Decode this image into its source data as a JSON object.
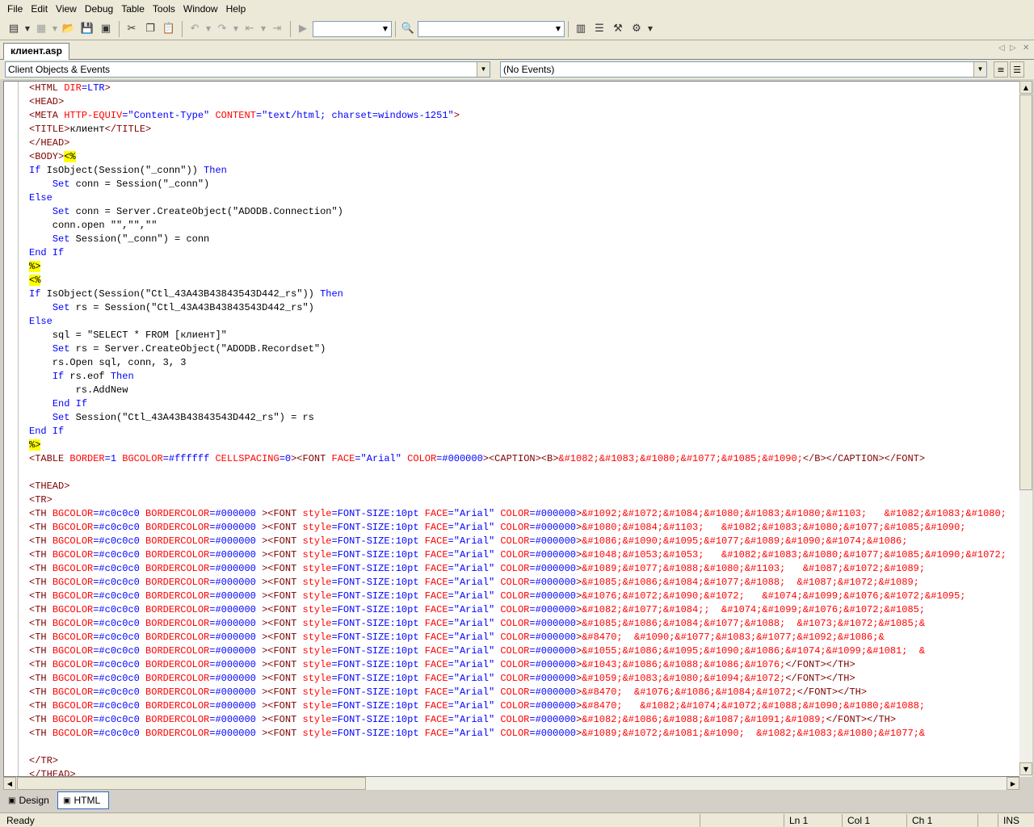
{
  "menu": [
    "File",
    "Edit",
    "View",
    "Debug",
    "Table",
    "Tools",
    "Window",
    "Help"
  ],
  "document_tab": "клиент.asp",
  "object_selector": "Client Objects & Events",
  "event_selector": "(No Events)",
  "code_lines": [
    [
      [
        "t",
        "<HTML "
      ],
      [
        "a",
        "DIR"
      ],
      [
        "v",
        "=LTR"
      ],
      [
        "t",
        ">"
      ]
    ],
    [
      [
        "t",
        "<HEAD>"
      ]
    ],
    [
      [
        "t",
        "<META "
      ],
      [
        "a",
        "HTTP-EQUIV"
      ],
      [
        "v",
        "=\"Content-Type\" "
      ],
      [
        "a",
        "CONTENT"
      ],
      [
        "v",
        "=\"text/html; charset=windows-1251\""
      ],
      [
        "t",
        ">"
      ]
    ],
    [
      [
        "t",
        "<TITLE>"
      ],
      [
        "p",
        "клиент"
      ],
      [
        "t",
        "</TITLE>"
      ]
    ],
    [
      [
        "t",
        "</HEAD>"
      ]
    ],
    [
      [
        "t",
        "<BODY>"
      ],
      [
        "d",
        "<%"
      ]
    ],
    [
      [
        "k",
        "If "
      ],
      [
        "p",
        "IsObject(Session(\"_conn\")) "
      ],
      [
        "k",
        "Then"
      ]
    ],
    [
      [
        "p",
        "    "
      ],
      [
        "k",
        "Set "
      ],
      [
        "p",
        "conn = Session(\"_conn\")"
      ]
    ],
    [
      [
        "k",
        "Else"
      ]
    ],
    [
      [
        "p",
        "    "
      ],
      [
        "k",
        "Set "
      ],
      [
        "p",
        "conn = Server.CreateObject(\"ADODB.Connection\")"
      ]
    ],
    [
      [
        "p",
        "    conn.open \"\",\"\",\"\""
      ]
    ],
    [
      [
        "p",
        "    "
      ],
      [
        "k",
        "Set "
      ],
      [
        "p",
        "Session(\"_conn\") = conn"
      ]
    ],
    [
      [
        "k",
        "End If"
      ]
    ],
    [
      [
        "d",
        "%>"
      ]
    ],
    [
      [
        "d",
        "<%"
      ]
    ],
    [
      [
        "k",
        "If "
      ],
      [
        "p",
        "IsObject(Session(\"Ctl_43A43B43843543D442_rs\")) "
      ],
      [
        "k",
        "Then"
      ]
    ],
    [
      [
        "p",
        "    "
      ],
      [
        "k",
        "Set "
      ],
      [
        "p",
        "rs = Session(\"Ctl_43A43B43843543D442_rs\")"
      ]
    ],
    [
      [
        "k",
        "Else"
      ]
    ],
    [
      [
        "p",
        "    sql = \"SELECT * FROM [клиент]\""
      ]
    ],
    [
      [
        "p",
        "    "
      ],
      [
        "k",
        "Set "
      ],
      [
        "p",
        "rs = Server.CreateObject(\"ADODB.Recordset\")"
      ]
    ],
    [
      [
        "p",
        "    rs.Open sql, conn, 3, 3"
      ]
    ],
    [
      [
        "p",
        "    "
      ],
      [
        "k",
        "If "
      ],
      [
        "p",
        "rs.eof "
      ],
      [
        "k",
        "Then"
      ]
    ],
    [
      [
        "p",
        "        rs.AddNew"
      ]
    ],
    [
      [
        "p",
        "    "
      ],
      [
        "k",
        "End If"
      ]
    ],
    [
      [
        "p",
        "    "
      ],
      [
        "k",
        "Set "
      ],
      [
        "p",
        "Session(\"Ctl_43A43B43843543D442_rs\") = rs"
      ]
    ],
    [
      [
        "k",
        "End If"
      ]
    ],
    [
      [
        "d",
        "%>"
      ]
    ],
    [
      [
        "t",
        "<TABLE "
      ],
      [
        "a",
        "BORDER"
      ],
      [
        "v",
        "=1 "
      ],
      [
        "a",
        "BGCOLOR"
      ],
      [
        "v",
        "=#ffffff "
      ],
      [
        "a",
        "CELLSPACING"
      ],
      [
        "v",
        "=0"
      ],
      [
        "t",
        "><FONT "
      ],
      [
        "a",
        "FACE"
      ],
      [
        "v",
        "=\"Arial\" "
      ],
      [
        "a",
        "COLOR"
      ],
      [
        "v",
        "=#000000"
      ],
      [
        "t",
        "><CAPTION><B>"
      ],
      [
        "a",
        "&#1082;&#1083;&#1080;&#1077;&#1085;&#1090;"
      ],
      [
        "t",
        "</B></CAPTION></FONT>"
      ]
    ],
    [
      [
        "p",
        ""
      ]
    ],
    [
      [
        "t",
        "<THEAD>"
      ]
    ],
    [
      [
        "t",
        "<TR>"
      ]
    ],
    [
      [
        "t",
        "<TH "
      ],
      [
        "a",
        "BGCOLOR"
      ],
      [
        "v",
        "=#c0c0c0 "
      ],
      [
        "a",
        "BORDERCOLOR"
      ],
      [
        "v",
        "=#000000 "
      ],
      [
        "t",
        "><FONT "
      ],
      [
        "a",
        "style"
      ],
      [
        "v",
        "=FONT-SIZE:10pt "
      ],
      [
        "a",
        "FACE"
      ],
      [
        "v",
        "=\"Arial\" "
      ],
      [
        "a",
        "COLOR"
      ],
      [
        "v",
        "=#000000"
      ],
      [
        "t",
        ">"
      ],
      [
        "a",
        "&#1092;&#1072;&#1084;&#1080;&#1083;&#1080;&#1103;   &#1082;&#1083;&#1080;"
      ]
    ],
    [
      [
        "t",
        "<TH "
      ],
      [
        "a",
        "BGCOLOR"
      ],
      [
        "v",
        "=#c0c0c0 "
      ],
      [
        "a",
        "BORDERCOLOR"
      ],
      [
        "v",
        "=#000000 "
      ],
      [
        "t",
        "><FONT "
      ],
      [
        "a",
        "style"
      ],
      [
        "v",
        "=FONT-SIZE:10pt "
      ],
      [
        "a",
        "FACE"
      ],
      [
        "v",
        "=\"Arial\" "
      ],
      [
        "a",
        "COLOR"
      ],
      [
        "v",
        "=#000000"
      ],
      [
        "t",
        ">"
      ],
      [
        "a",
        "&#1080;&#1084;&#1103;   &#1082;&#1083;&#1080;&#1077;&#1085;&#1090;"
      ]
    ],
    [
      [
        "t",
        "<TH "
      ],
      [
        "a",
        "BGCOLOR"
      ],
      [
        "v",
        "=#c0c0c0 "
      ],
      [
        "a",
        "BORDERCOLOR"
      ],
      [
        "v",
        "=#000000 "
      ],
      [
        "t",
        "><FONT "
      ],
      [
        "a",
        "style"
      ],
      [
        "v",
        "=FONT-SIZE:10pt "
      ],
      [
        "a",
        "FACE"
      ],
      [
        "v",
        "=\"Arial\" "
      ],
      [
        "a",
        "COLOR"
      ],
      [
        "v",
        "=#000000"
      ],
      [
        "t",
        ">"
      ],
      [
        "a",
        "&#1086;&#1090;&#1095;&#1077;&#1089;&#1090;&#1074;&#1086;"
      ]
    ],
    [
      [
        "t",
        "<TH "
      ],
      [
        "a",
        "BGCOLOR"
      ],
      [
        "v",
        "=#c0c0c0 "
      ],
      [
        "a",
        "BORDERCOLOR"
      ],
      [
        "v",
        "=#000000 "
      ],
      [
        "t",
        "><FONT "
      ],
      [
        "a",
        "style"
      ],
      [
        "v",
        "=FONT-SIZE:10pt "
      ],
      [
        "a",
        "FACE"
      ],
      [
        "v",
        "=\"Arial\" "
      ],
      [
        "a",
        "COLOR"
      ],
      [
        "v",
        "=#000000"
      ],
      [
        "t",
        ">"
      ],
      [
        "a",
        "&#1048;&#1053;&#1053;   &#1082;&#1083;&#1080;&#1077;&#1085;&#1090;&#1072;"
      ]
    ],
    [
      [
        "t",
        "<TH "
      ],
      [
        "a",
        "BGCOLOR"
      ],
      [
        "v",
        "=#c0c0c0 "
      ],
      [
        "a",
        "BORDERCOLOR"
      ],
      [
        "v",
        "=#000000 "
      ],
      [
        "t",
        "><FONT "
      ],
      [
        "a",
        "style"
      ],
      [
        "v",
        "=FONT-SIZE:10pt "
      ],
      [
        "a",
        "FACE"
      ],
      [
        "v",
        "=\"Arial\" "
      ],
      [
        "a",
        "COLOR"
      ],
      [
        "v",
        "=#000000"
      ],
      [
        "t",
        ">"
      ],
      [
        "a",
        "&#1089;&#1077;&#1088;&#1080;&#1103;   &#1087;&#1072;&#1089;"
      ]
    ],
    [
      [
        "t",
        "<TH "
      ],
      [
        "a",
        "BGCOLOR"
      ],
      [
        "v",
        "=#c0c0c0 "
      ],
      [
        "a",
        "BORDERCOLOR"
      ],
      [
        "v",
        "=#000000 "
      ],
      [
        "t",
        "><FONT "
      ],
      [
        "a",
        "style"
      ],
      [
        "v",
        "=FONT-SIZE:10pt "
      ],
      [
        "a",
        "FACE"
      ],
      [
        "v",
        "=\"Arial\" "
      ],
      [
        "a",
        "COLOR"
      ],
      [
        "v",
        "=#000000"
      ],
      [
        "t",
        ">"
      ],
      [
        "a",
        "&#1085;&#1086;&#1084;&#1077;&#1088;  &#1087;&#1072;&#1089;"
      ]
    ],
    [
      [
        "t",
        "<TH "
      ],
      [
        "a",
        "BGCOLOR"
      ],
      [
        "v",
        "=#c0c0c0 "
      ],
      [
        "a",
        "BORDERCOLOR"
      ],
      [
        "v",
        "=#000000 "
      ],
      [
        "t",
        "><FONT "
      ],
      [
        "a",
        "style"
      ],
      [
        "v",
        "=FONT-SIZE:10pt "
      ],
      [
        "a",
        "FACE"
      ],
      [
        "v",
        "=\"Arial\" "
      ],
      [
        "a",
        "COLOR"
      ],
      [
        "v",
        "=#000000"
      ],
      [
        "t",
        ">"
      ],
      [
        "a",
        "&#1076;&#1072;&#1090;&#1072;   &#1074;&#1099;&#1076;&#1072;&#1095;"
      ]
    ],
    [
      [
        "t",
        "<TH "
      ],
      [
        "a",
        "BGCOLOR"
      ],
      [
        "v",
        "=#c0c0c0 "
      ],
      [
        "a",
        "BORDERCOLOR"
      ],
      [
        "v",
        "=#000000 "
      ],
      [
        "t",
        "><FONT "
      ],
      [
        "a",
        "style"
      ],
      [
        "v",
        "=FONT-SIZE:10pt "
      ],
      [
        "a",
        "FACE"
      ],
      [
        "v",
        "=\"Arial\" "
      ],
      [
        "a",
        "COLOR"
      ],
      [
        "v",
        "=#000000"
      ],
      [
        "t",
        ">"
      ],
      [
        "a",
        "&#1082;&#1077;&#1084;;  &#1074;&#1099;&#1076;&#1072;&#1085;"
      ]
    ],
    [
      [
        "t",
        "<TH "
      ],
      [
        "a",
        "BGCOLOR"
      ],
      [
        "v",
        "=#c0c0c0 "
      ],
      [
        "a",
        "BORDERCOLOR"
      ],
      [
        "v",
        "=#000000 "
      ],
      [
        "t",
        "><FONT "
      ],
      [
        "a",
        "style"
      ],
      [
        "v",
        "=FONT-SIZE:10pt "
      ],
      [
        "a",
        "FACE"
      ],
      [
        "v",
        "=\"Arial\" "
      ],
      [
        "a",
        "COLOR"
      ],
      [
        "v",
        "=#000000"
      ],
      [
        "t",
        ">"
      ],
      [
        "a",
        "&#1085;&#1086;&#1084;&#1077;&#1088;  &#1073;&#1072;&#1085;&"
      ]
    ],
    [
      [
        "t",
        "<TH "
      ],
      [
        "a",
        "BGCOLOR"
      ],
      [
        "v",
        "=#c0c0c0 "
      ],
      [
        "a",
        "BORDERCOLOR"
      ],
      [
        "v",
        "=#000000 "
      ],
      [
        "t",
        "><FONT "
      ],
      [
        "a",
        "style"
      ],
      [
        "v",
        "=FONT-SIZE:10pt "
      ],
      [
        "a",
        "FACE"
      ],
      [
        "v",
        "=\"Arial\" "
      ],
      [
        "a",
        "COLOR"
      ],
      [
        "v",
        "=#000000"
      ],
      [
        "t",
        ">"
      ],
      [
        "a",
        "&#8470;  &#1090;&#1077;&#1083;&#1077;&#1092;&#1086;&"
      ]
    ],
    [
      [
        "t",
        "<TH "
      ],
      [
        "a",
        "BGCOLOR"
      ],
      [
        "v",
        "=#c0c0c0 "
      ],
      [
        "a",
        "BORDERCOLOR"
      ],
      [
        "v",
        "=#000000 "
      ],
      [
        "t",
        "><FONT "
      ],
      [
        "a",
        "style"
      ],
      [
        "v",
        "=FONT-SIZE:10pt "
      ],
      [
        "a",
        "FACE"
      ],
      [
        "v",
        "=\"Arial\" "
      ],
      [
        "a",
        "COLOR"
      ],
      [
        "v",
        "=#000000"
      ],
      [
        "t",
        ">"
      ],
      [
        "a",
        "&#1055;&#1086;&#1095;&#1090;&#1086;&#1074;&#1099;&#1081;  &"
      ]
    ],
    [
      [
        "t",
        "<TH "
      ],
      [
        "a",
        "BGCOLOR"
      ],
      [
        "v",
        "=#c0c0c0 "
      ],
      [
        "a",
        "BORDERCOLOR"
      ],
      [
        "v",
        "=#000000 "
      ],
      [
        "t",
        "><FONT "
      ],
      [
        "a",
        "style"
      ],
      [
        "v",
        "=FONT-SIZE:10pt "
      ],
      [
        "a",
        "FACE"
      ],
      [
        "v",
        "=\"Arial\" "
      ],
      [
        "a",
        "COLOR"
      ],
      [
        "v",
        "=#000000"
      ],
      [
        "t",
        ">"
      ],
      [
        "a",
        "&#1043;&#1086;&#1088;&#1086;&#1076;"
      ],
      [
        "t",
        "</FONT></TH>"
      ]
    ],
    [
      [
        "t",
        "<TH "
      ],
      [
        "a",
        "BGCOLOR"
      ],
      [
        "v",
        "=#c0c0c0 "
      ],
      [
        "a",
        "BORDERCOLOR"
      ],
      [
        "v",
        "=#000000 "
      ],
      [
        "t",
        "><FONT "
      ],
      [
        "a",
        "style"
      ],
      [
        "v",
        "=FONT-SIZE:10pt "
      ],
      [
        "a",
        "FACE"
      ],
      [
        "v",
        "=\"Arial\" "
      ],
      [
        "a",
        "COLOR"
      ],
      [
        "v",
        "=#000000"
      ],
      [
        "t",
        ">"
      ],
      [
        "a",
        "&#1059;&#1083;&#1080;&#1094;&#1072;"
      ],
      [
        "t",
        "</FONT></TH>"
      ]
    ],
    [
      [
        "t",
        "<TH "
      ],
      [
        "a",
        "BGCOLOR"
      ],
      [
        "v",
        "=#c0c0c0 "
      ],
      [
        "a",
        "BORDERCOLOR"
      ],
      [
        "v",
        "=#000000 "
      ],
      [
        "t",
        "><FONT "
      ],
      [
        "a",
        "style"
      ],
      [
        "v",
        "=FONT-SIZE:10pt "
      ],
      [
        "a",
        "FACE"
      ],
      [
        "v",
        "=\"Arial\" "
      ],
      [
        "a",
        "COLOR"
      ],
      [
        "v",
        "=#000000"
      ],
      [
        "t",
        ">"
      ],
      [
        "a",
        "&#8470;  &#1076;&#1086;&#1084;&#1072;"
      ],
      [
        "t",
        "</FONT></TH>"
      ]
    ],
    [
      [
        "t",
        "<TH "
      ],
      [
        "a",
        "BGCOLOR"
      ],
      [
        "v",
        "=#c0c0c0 "
      ],
      [
        "a",
        "BORDERCOLOR"
      ],
      [
        "v",
        "=#000000 "
      ],
      [
        "t",
        "><FONT "
      ],
      [
        "a",
        "style"
      ],
      [
        "v",
        "=FONT-SIZE:10pt "
      ],
      [
        "a",
        "FACE"
      ],
      [
        "v",
        "=\"Arial\" "
      ],
      [
        "a",
        "COLOR"
      ],
      [
        "v",
        "=#000000"
      ],
      [
        "t",
        ">"
      ],
      [
        "a",
        "&#8470;   &#1082;&#1074;&#1072;&#1088;&#1090;&#1080;&#1088;"
      ]
    ],
    [
      [
        "t",
        "<TH "
      ],
      [
        "a",
        "BGCOLOR"
      ],
      [
        "v",
        "=#c0c0c0 "
      ],
      [
        "a",
        "BORDERCOLOR"
      ],
      [
        "v",
        "=#000000 "
      ],
      [
        "t",
        "><FONT "
      ],
      [
        "a",
        "style"
      ],
      [
        "v",
        "=FONT-SIZE:10pt "
      ],
      [
        "a",
        "FACE"
      ],
      [
        "v",
        "=\"Arial\" "
      ],
      [
        "a",
        "COLOR"
      ],
      [
        "v",
        "=#000000"
      ],
      [
        "t",
        ">"
      ],
      [
        "a",
        "&#1082;&#1086;&#1088;&#1087;&#1091;&#1089;"
      ],
      [
        "t",
        "</FONT></TH>"
      ]
    ],
    [
      [
        "t",
        "<TH "
      ],
      [
        "a",
        "BGCOLOR"
      ],
      [
        "v",
        "=#c0c0c0 "
      ],
      [
        "a",
        "BORDERCOLOR"
      ],
      [
        "v",
        "=#000000 "
      ],
      [
        "t",
        "><FONT "
      ],
      [
        "a",
        "style"
      ],
      [
        "v",
        "=FONT-SIZE:10pt "
      ],
      [
        "a",
        "FACE"
      ],
      [
        "v",
        "=\"Arial\" "
      ],
      [
        "a",
        "COLOR"
      ],
      [
        "v",
        "=#000000"
      ],
      [
        "t",
        ">"
      ],
      [
        "a",
        "&#1089;&#1072;&#1081;&#1090;  &#1082;&#1083;&#1080;&#1077;&"
      ]
    ],
    [
      [
        "p",
        ""
      ]
    ],
    [
      [
        "t",
        "</TR>"
      ]
    ],
    [
      [
        "t",
        "</THEAD>"
      ]
    ]
  ],
  "view_tabs": {
    "design": "Design",
    "html": "HTML"
  },
  "status": {
    "text": "Ready",
    "ln": "Ln 1",
    "col": "Col 1",
    "ch": "Ch 1",
    "mode": "INS"
  }
}
